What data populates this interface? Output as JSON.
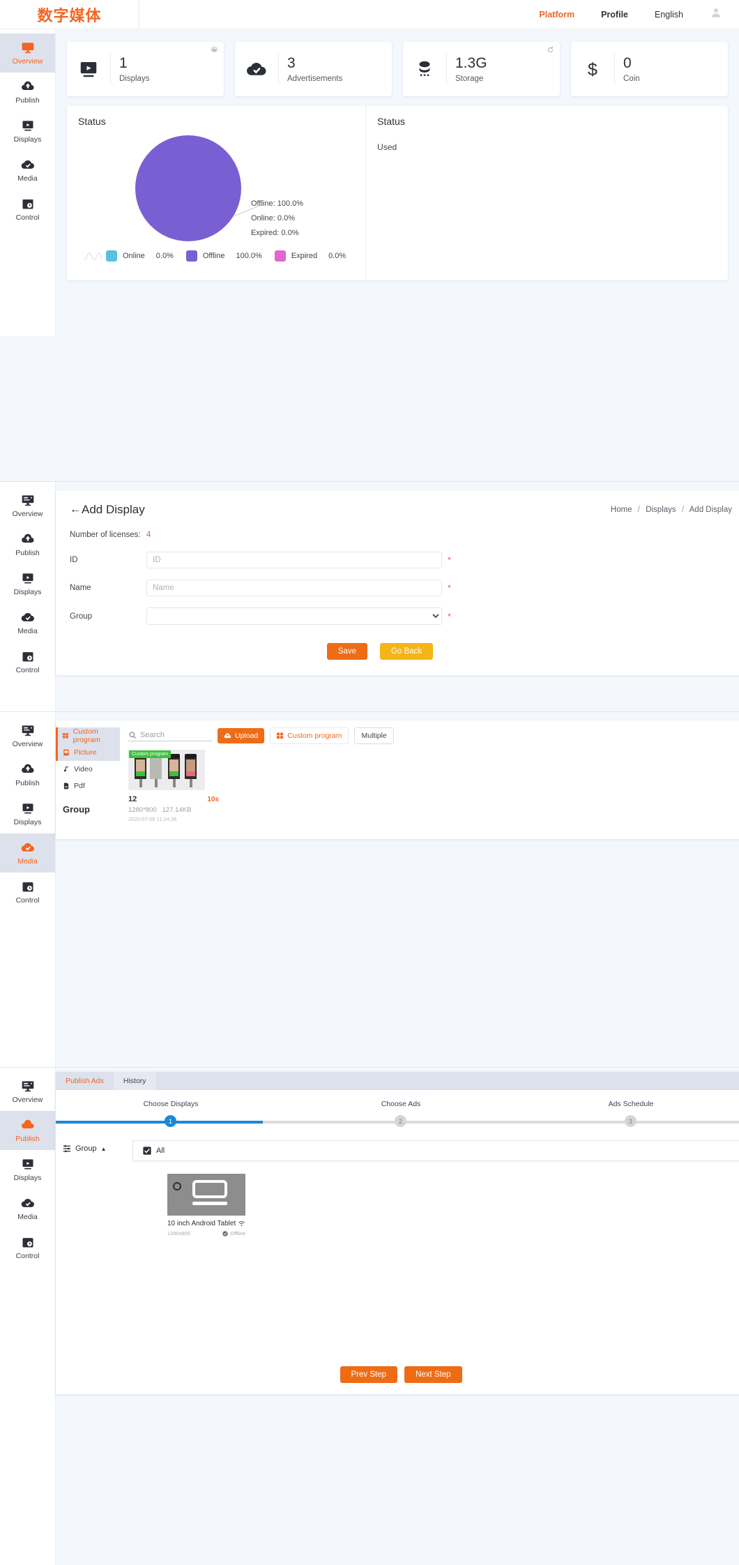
{
  "header": {
    "brand": "数字媒体",
    "nav": [
      {
        "label": "Platform",
        "state": "active"
      },
      {
        "label": "Profile",
        "state": "bold"
      },
      {
        "label": "English",
        "state": "normal"
      }
    ],
    "avatar_icon": "user-avatar-icon"
  },
  "sidebar": {
    "items": [
      {
        "label": "Overview",
        "icon": "monitor-overview-icon"
      },
      {
        "label": "Publish",
        "icon": "cloud-upload-icon"
      },
      {
        "label": "Displays",
        "icon": "screen-play-icon"
      },
      {
        "label": "Media",
        "icon": "cloud-check-icon"
      },
      {
        "label": "Control",
        "icon": "calendar-clock-icon"
      }
    ]
  },
  "overview": {
    "stats": [
      {
        "value": "1",
        "label": "Displays",
        "icon": "screen-play-icon",
        "corner_icon": "gear-icon"
      },
      {
        "value": "3",
        "label": "Advertisements",
        "icon": "cloud-check-icon",
        "corner_icon": ""
      },
      {
        "value": "1.3G",
        "label": "Storage",
        "icon": "database-icon",
        "corner_icon": "refresh-icon"
      },
      {
        "value": "0",
        "label": "Coin",
        "icon": "dollar-icon",
        "corner_icon": ""
      }
    ],
    "status_panel_title": "Status",
    "usage_panel_title": "Status",
    "usage_sub": "Used",
    "chart_data": {
      "type": "pie",
      "title": "Status",
      "categories": [
        "Online",
        "Offline",
        "Expired"
      ],
      "values": [
        0.0,
        100.0,
        0.0
      ],
      "colors": [
        "#5bc0de",
        "#7a5fd3",
        "#e265d2"
      ],
      "labels": [
        "Offline: 100.0%",
        "Online: 0.0%",
        "Expired: 0.0%"
      ],
      "legend": [
        {
          "name": "Online",
          "percent": "0.0%",
          "color": "#5bc0de"
        },
        {
          "name": "Offline",
          "percent": "100.0%",
          "color": "#7a5fd3"
        },
        {
          "name": "Expired",
          "percent": "0.0%",
          "color": "#e265d2"
        }
      ],
      "legend_position": "bottom",
      "grid": false
    }
  },
  "add_display": {
    "back_icon": "arrow-left-icon",
    "title": "Add Display",
    "breadcrumb": [
      "Home",
      "Displays",
      "Add Display"
    ],
    "licenses_label": "Number of licenses:",
    "licenses_value": "4",
    "fields": [
      {
        "label": "ID",
        "placeholder": "ID",
        "value": "",
        "required": "*"
      },
      {
        "label": "Name",
        "placeholder": "Name",
        "value": "",
        "required": "*"
      },
      {
        "label": "Group",
        "placeholder": "",
        "value": "",
        "required": "*"
      }
    ],
    "save_label": "Save",
    "goback_label": "Go Back"
  },
  "media": {
    "tabs": [
      {
        "label": "Custom program",
        "icon": "windows-tile-icon",
        "state": "active"
      },
      {
        "label": "Picture",
        "icon": "image-icon",
        "state": "active"
      },
      {
        "label": "Video",
        "icon": "music-note-icon",
        "state": "normal"
      },
      {
        "label": "Pdf",
        "icon": "pdf-file-icon",
        "state": "normal"
      }
    ],
    "search_placeholder": "Search",
    "search_value": "",
    "search_icon": "search-icon",
    "upload_label": "Upload",
    "upload_icon": "cloud-upload-icon",
    "custom_label": "Custom program",
    "custom_icon": "windows-tile-icon",
    "multiple_label": "Multiple",
    "group_label": "Group",
    "item": {
      "badge": "Custom program",
      "name": "12",
      "duration": "10s",
      "resolution": "1280*800",
      "size": "127.14KB",
      "date": "2020-07-06 11:24:28"
    }
  },
  "publish": {
    "tabs": [
      {
        "label": "Publish Ads",
        "state": "active"
      },
      {
        "label": "History",
        "state": "normal"
      }
    ],
    "steps": [
      {
        "num": "1",
        "label": "Choose Displays",
        "state": "active"
      },
      {
        "num": "2",
        "label": "Choose Ads",
        "state": "normal"
      },
      {
        "num": "3",
        "label": "Ads Schedule",
        "state": "normal"
      }
    ],
    "progress_percent": 30,
    "group_label": "Group",
    "group_icon": "filter-icon",
    "group_chevron": "chevron-up-icon",
    "all_label": "All",
    "all_checked": true,
    "display": {
      "name": "10 inch Android Tablet",
      "wifi_icon": "wifi-icon",
      "resolution": "1280x800",
      "status": "Offline",
      "status_icon": "check-circle-icon"
    },
    "prev_label": "Prev Step",
    "next_label": "Next Step"
  }
}
